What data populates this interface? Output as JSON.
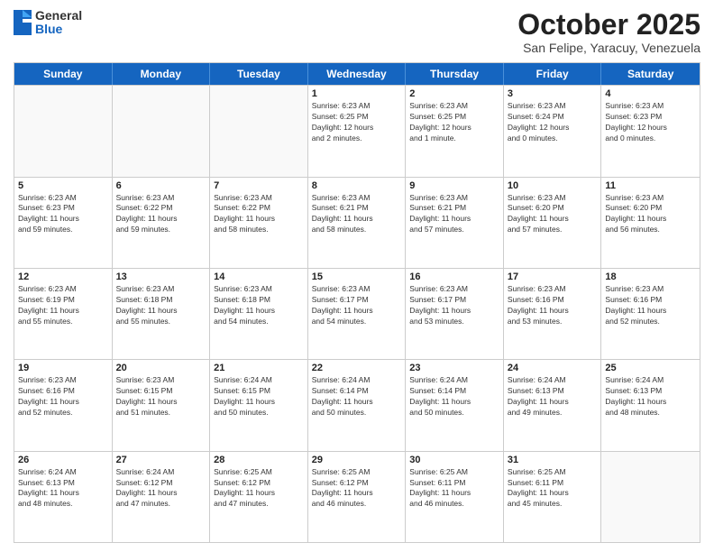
{
  "logo": {
    "general": "General",
    "blue": "Blue"
  },
  "header": {
    "month": "October 2025",
    "location": "San Felipe, Yaracuy, Venezuela"
  },
  "weekdays": [
    "Sunday",
    "Monday",
    "Tuesday",
    "Wednesday",
    "Thursday",
    "Friday",
    "Saturday"
  ],
  "weeks": [
    [
      {
        "day": "",
        "info": ""
      },
      {
        "day": "",
        "info": ""
      },
      {
        "day": "",
        "info": ""
      },
      {
        "day": "1",
        "info": "Sunrise: 6:23 AM\nSunset: 6:25 PM\nDaylight: 12 hours\nand 2 minutes."
      },
      {
        "day": "2",
        "info": "Sunrise: 6:23 AM\nSunset: 6:25 PM\nDaylight: 12 hours\nand 1 minute."
      },
      {
        "day": "3",
        "info": "Sunrise: 6:23 AM\nSunset: 6:24 PM\nDaylight: 12 hours\nand 0 minutes."
      },
      {
        "day": "4",
        "info": "Sunrise: 6:23 AM\nSunset: 6:23 PM\nDaylight: 12 hours\nand 0 minutes."
      }
    ],
    [
      {
        "day": "5",
        "info": "Sunrise: 6:23 AM\nSunset: 6:23 PM\nDaylight: 11 hours\nand 59 minutes."
      },
      {
        "day": "6",
        "info": "Sunrise: 6:23 AM\nSunset: 6:22 PM\nDaylight: 11 hours\nand 59 minutes."
      },
      {
        "day": "7",
        "info": "Sunrise: 6:23 AM\nSunset: 6:22 PM\nDaylight: 11 hours\nand 58 minutes."
      },
      {
        "day": "8",
        "info": "Sunrise: 6:23 AM\nSunset: 6:21 PM\nDaylight: 11 hours\nand 58 minutes."
      },
      {
        "day": "9",
        "info": "Sunrise: 6:23 AM\nSunset: 6:21 PM\nDaylight: 11 hours\nand 57 minutes."
      },
      {
        "day": "10",
        "info": "Sunrise: 6:23 AM\nSunset: 6:20 PM\nDaylight: 11 hours\nand 57 minutes."
      },
      {
        "day": "11",
        "info": "Sunrise: 6:23 AM\nSunset: 6:20 PM\nDaylight: 11 hours\nand 56 minutes."
      }
    ],
    [
      {
        "day": "12",
        "info": "Sunrise: 6:23 AM\nSunset: 6:19 PM\nDaylight: 11 hours\nand 55 minutes."
      },
      {
        "day": "13",
        "info": "Sunrise: 6:23 AM\nSunset: 6:18 PM\nDaylight: 11 hours\nand 55 minutes."
      },
      {
        "day": "14",
        "info": "Sunrise: 6:23 AM\nSunset: 6:18 PM\nDaylight: 11 hours\nand 54 minutes."
      },
      {
        "day": "15",
        "info": "Sunrise: 6:23 AM\nSunset: 6:17 PM\nDaylight: 11 hours\nand 54 minutes."
      },
      {
        "day": "16",
        "info": "Sunrise: 6:23 AM\nSunset: 6:17 PM\nDaylight: 11 hours\nand 53 minutes."
      },
      {
        "day": "17",
        "info": "Sunrise: 6:23 AM\nSunset: 6:16 PM\nDaylight: 11 hours\nand 53 minutes."
      },
      {
        "day": "18",
        "info": "Sunrise: 6:23 AM\nSunset: 6:16 PM\nDaylight: 11 hours\nand 52 minutes."
      }
    ],
    [
      {
        "day": "19",
        "info": "Sunrise: 6:23 AM\nSunset: 6:16 PM\nDaylight: 11 hours\nand 52 minutes."
      },
      {
        "day": "20",
        "info": "Sunrise: 6:23 AM\nSunset: 6:15 PM\nDaylight: 11 hours\nand 51 minutes."
      },
      {
        "day": "21",
        "info": "Sunrise: 6:24 AM\nSunset: 6:15 PM\nDaylight: 11 hours\nand 50 minutes."
      },
      {
        "day": "22",
        "info": "Sunrise: 6:24 AM\nSunset: 6:14 PM\nDaylight: 11 hours\nand 50 minutes."
      },
      {
        "day": "23",
        "info": "Sunrise: 6:24 AM\nSunset: 6:14 PM\nDaylight: 11 hours\nand 50 minutes."
      },
      {
        "day": "24",
        "info": "Sunrise: 6:24 AM\nSunset: 6:13 PM\nDaylight: 11 hours\nand 49 minutes."
      },
      {
        "day": "25",
        "info": "Sunrise: 6:24 AM\nSunset: 6:13 PM\nDaylight: 11 hours\nand 48 minutes."
      }
    ],
    [
      {
        "day": "26",
        "info": "Sunrise: 6:24 AM\nSunset: 6:13 PM\nDaylight: 11 hours\nand 48 minutes."
      },
      {
        "day": "27",
        "info": "Sunrise: 6:24 AM\nSunset: 6:12 PM\nDaylight: 11 hours\nand 47 minutes."
      },
      {
        "day": "28",
        "info": "Sunrise: 6:25 AM\nSunset: 6:12 PM\nDaylight: 11 hours\nand 47 minutes."
      },
      {
        "day": "29",
        "info": "Sunrise: 6:25 AM\nSunset: 6:12 PM\nDaylight: 11 hours\nand 46 minutes."
      },
      {
        "day": "30",
        "info": "Sunrise: 6:25 AM\nSunset: 6:11 PM\nDaylight: 11 hours\nand 46 minutes."
      },
      {
        "day": "31",
        "info": "Sunrise: 6:25 AM\nSunset: 6:11 PM\nDaylight: 11 hours\nand 45 minutes."
      },
      {
        "day": "",
        "info": ""
      }
    ]
  ]
}
